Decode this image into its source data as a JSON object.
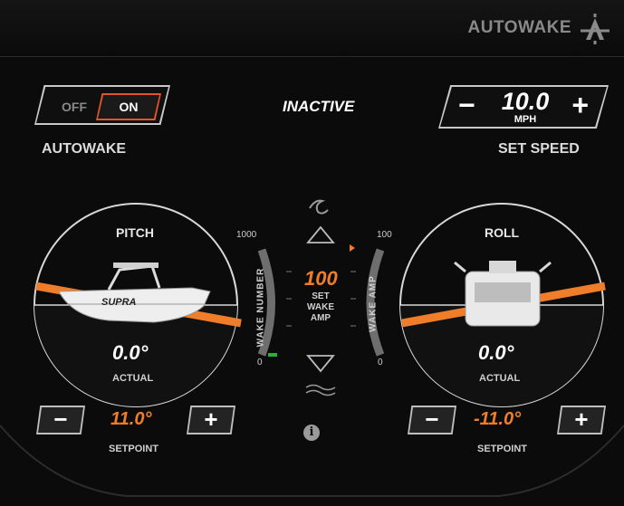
{
  "header": {
    "brand": "AUTOWAKE"
  },
  "autowake": {
    "off_label": "OFF",
    "on_label": "ON",
    "label": "AUTOWAKE",
    "state": "on"
  },
  "status": "INACTIVE",
  "speed": {
    "minus": "−",
    "value": "10.0",
    "unit": "MPH",
    "plus": "+",
    "label": "SET SPEED"
  },
  "pitch": {
    "title": "PITCH",
    "actual": "0.0°",
    "actual_label": "ACTUAL",
    "setpoint": "11.0°",
    "setpoint_label": "SETPOINT",
    "minus": "−",
    "plus": "+",
    "hull_text": "SUPRA"
  },
  "roll": {
    "title": "ROLL",
    "actual": "0.0°",
    "actual_label": "ACTUAL",
    "setpoint": "-11.0°",
    "setpoint_label": "SETPOINT",
    "minus": "−",
    "plus": "+"
  },
  "wake_number": {
    "label": "WAKE NUMBER",
    "max": "1000",
    "min": "0"
  },
  "wake_amp": {
    "label": "WAKE AMP",
    "max": "100",
    "min": "0",
    "value": "100",
    "set_label_1": "SET",
    "set_label_2": "WAKE",
    "set_label_3": "AMP"
  },
  "colors": {
    "accent": "#f07d2a",
    "toggle_on_border": "#e2542c",
    "meter_green": "#2fae3f"
  },
  "icons": [
    "autowake-logo-icon",
    "wave-icon",
    "up-arrow-icon",
    "down-arrow-icon",
    "ripple-icon",
    "info-icon"
  ]
}
